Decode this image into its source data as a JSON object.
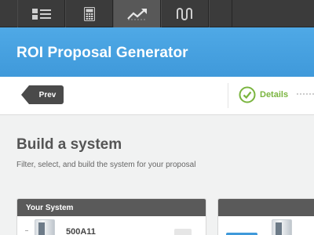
{
  "toolbar": {
    "tools": [
      {
        "icon": "list-icon",
        "active": false
      },
      {
        "icon": "calculator-icon",
        "active": false
      },
      {
        "icon": "trend-chart-icon",
        "active": true
      },
      {
        "icon": "wave-icon",
        "active": false
      }
    ]
  },
  "header": {
    "title": "ROI Proposal Generator"
  },
  "stepbar": {
    "prev_label": "Prev",
    "current_step": "Details",
    "step_status_icon": "check-circle-icon"
  },
  "main": {
    "title": "Build a system",
    "subtitle": "Filter, select, and build the system for your proposal"
  },
  "panels": {
    "your_system": {
      "title": "Your System",
      "items": [
        {
          "name": "500A11",
          "icon": "product-unit-icon"
        }
      ]
    },
    "catalog": {
      "title": ""
    }
  },
  "colors": {
    "toolbar": "#3b3b3b",
    "header_blue": "#4aa3e2",
    "success_green": "#7ab53f",
    "panel_header": "#5a5a5a"
  }
}
